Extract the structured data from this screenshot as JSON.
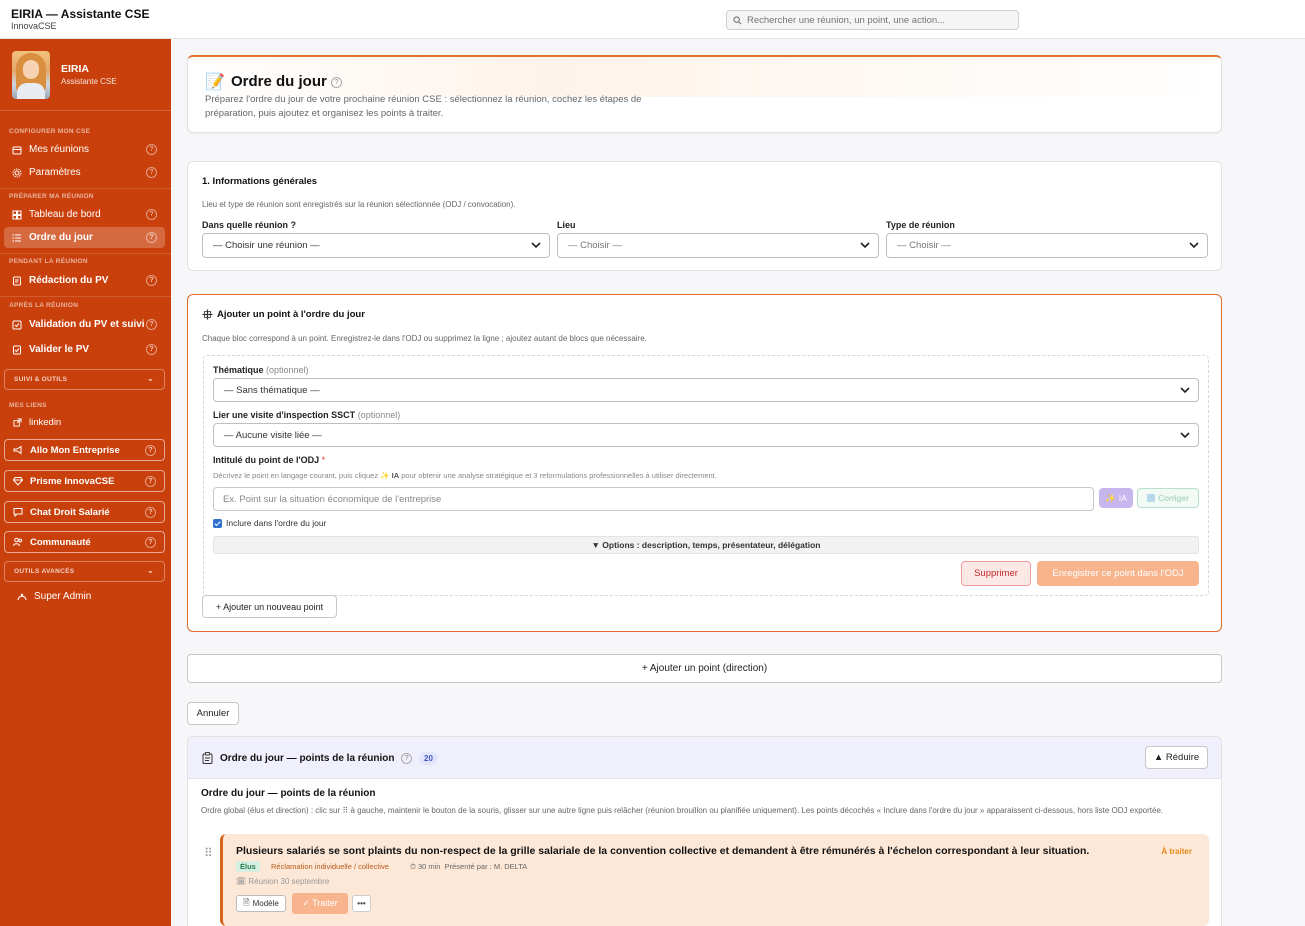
{
  "app": {
    "title": "EIRIA — Assistante CSE",
    "subtitle": "InnovaCSE"
  },
  "search": {
    "placeholder": "Rechercher une réunion, un point, une action..."
  },
  "profile": {
    "name": "EIRIA",
    "role": "Assistante CSE"
  },
  "sidebar": {
    "sections": {
      "configure": "CONFIGURER MON CSE",
      "prepare": "PRÉPARER MA RÉUNION",
      "during": "PENDANT LA RÉUNION",
      "after": "APRÈS LA RÉUNION",
      "tracking": "SUIVI & OUTILS",
      "links": "MES LIENS",
      "advanced": "OUTILS AVANCÉS"
    },
    "items": {
      "reunions": "Mes réunions",
      "parametres": "Paramètres",
      "tableau": "Tableau de bord",
      "odj": "Ordre du jour",
      "redaction": "Rédaction du PV",
      "validation": "Validation du PV et suivi",
      "valider": "Valider le PV",
      "linkedin": "linkedin",
      "allo": "Allo Mon Entreprise",
      "prisme": "Prisme InnovaCSE",
      "chat": "Chat Droit Salarié",
      "communaute": "Communauté",
      "superadmin": "Super Admin"
    },
    "help_glyph": "?",
    "chevron": "⌄"
  },
  "page": {
    "title": "Ordre du jour",
    "help_glyph": "?",
    "description": "Préparez l'ordre du jour de votre prochaine réunion CSE : sélectionnez la réunion, cochez les étapes de préparation, puis ajoutez et organisez les points à traiter."
  },
  "info": {
    "title": "1. Informations générales",
    "desc": "Lieu et type de réunion sont enregistrés sur la réunion sélectionnée (ODJ / convocation).",
    "meeting_label": "Dans quelle réunion ?",
    "meeting_value": "— Choisir une réunion —",
    "place_label": "Lieu",
    "place_value": "— Choisir —",
    "type_label": "Type de réunion",
    "type_value": "— Choisir —"
  },
  "add_point": {
    "title": "Ajouter un point à l'ordre du jour",
    "desc": "Chaque bloc correspond à un point. Enregistrez-le dans l'ODJ ou supprimez la ligne ; ajoutez autant de blocs que nécessaire.",
    "theme_label": "Thématique",
    "theme_optional": "(optionnel)",
    "theme_value": "— Sans thématique —",
    "visit_label": "Lier une visite d'inspection SSCT",
    "visit_optional": "(optionnel)",
    "visit_value": "— Aucune visite liée —",
    "intitule_label": "Intitulé du point de l'ODJ",
    "required_mark": "*",
    "intitule_hint_a": "Décrivez le point en langage courant, puis cliquez",
    "intitule_hint_ia": "IA",
    "intitule_hint_b": "pour obtenir une analyse stratégique et 3 reformulations professionnelles à utiliser directement.",
    "intitule_placeholder": "Ex. Point sur la situation économique de l'entreprise",
    "ia_button": "IA",
    "corriger_button": "Corriger",
    "include_label": "Inclure dans l'ordre du jour",
    "options_label": "▼ Options : description, temps, présentateur, délégation",
    "delete_button": "Supprimer",
    "save_button": "Enregistrer ce point dans l'ODJ",
    "new_point_button": "+ Ajouter un nouveau point"
  },
  "direction_button": "+ Ajouter un point (direction)",
  "cancel_button": "Annuler",
  "odj_list": {
    "title": "Ordre du jour — points de la réunion",
    "help_glyph": "?",
    "count": "20",
    "reduce_button": "▲ Réduire",
    "subtitle": "Ordre du jour — points de la réunion",
    "desc": "Ordre global (élus et direction) : clic sur ⠿ à gauche, maintenir le bouton de la souris, glisser sur une autre ligne puis relâcher (réunion brouillon ou planifiée uniquement). Les points décochés « Inclure dans l'ordre du jour » apparaissent ci-dessous, hors liste ODJ exportée.",
    "drag_handle": "⠿",
    "point": {
      "title": "Plusieurs salariés se sont plaints du non-respect de la grille salariale de la convention collective et demandent à être rémunérés à l'échelon correspondant à leur situation.",
      "status": "À traiter",
      "tag": "Élus",
      "theme": "Réclamation individuelle / collective",
      "duration": "30 min",
      "presenter": "Présenté par : M. DELTA",
      "reunion": "Réunion 30 septembre",
      "model_button": "Modèle",
      "treat_button": "✓ Traiter",
      "more_button": "•••"
    }
  },
  "colors": {
    "sidebar": "#c9400c",
    "accent": "#e06a2c",
    "save": "#f7b48d",
    "point_bg": "#fde7d6"
  }
}
